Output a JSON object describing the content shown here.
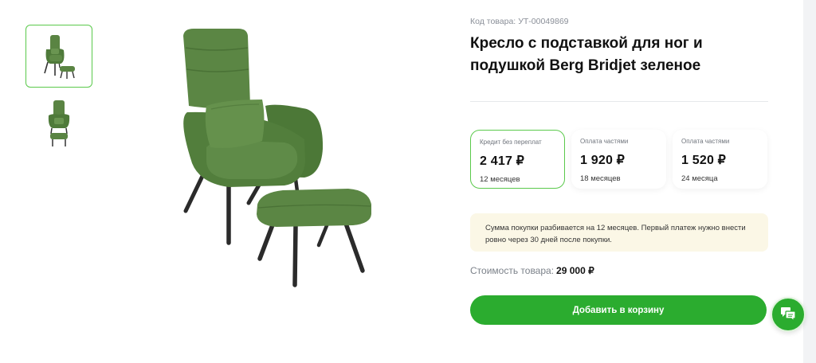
{
  "product": {
    "sku_label": "Код товара:",
    "sku_value": "УТ-00049869",
    "title": "Кресло с подставкой для ног и подушкой Berg Bridjet зеленое"
  },
  "plans": [
    {
      "label": "Кредит без переплат",
      "price": "2 417 ₽",
      "term": "12 месяцев",
      "selected": true
    },
    {
      "label": "Оплата частями",
      "price": "1 920 ₽",
      "term": "18 месяцев",
      "selected": false
    },
    {
      "label": "Оплата частями",
      "price": "1 520 ₽",
      "term": "24 месяца",
      "selected": false
    }
  ],
  "notice": "Сумма покупки разбивается на 12 месяцев. Первый платеж нужно внести ровно через 30 дней после покупки.",
  "price": {
    "label": "Стоимость товара:",
    "value": "29 000 ₽"
  },
  "cart_button": "Добавить в корзину",
  "colors": {
    "accent": "#2bac2f",
    "accent_border": "#5ac94b",
    "notice_bg": "#fbf7e6",
    "chair": "#55803f"
  },
  "icons": {
    "chat": "chat-bubbles-icon"
  }
}
